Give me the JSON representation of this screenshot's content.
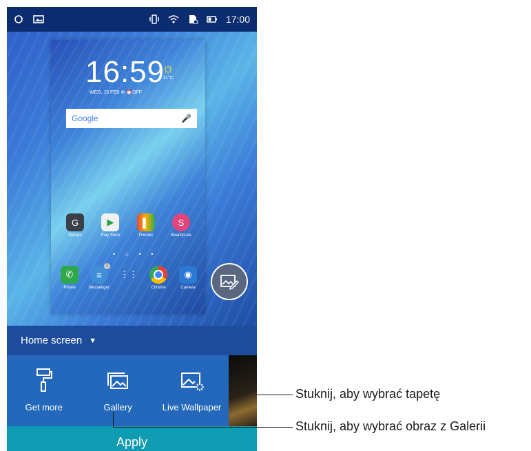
{
  "status_bar": {
    "time": "17:00"
  },
  "preview": {
    "clock": "16:59",
    "date": "WED, 15 FEB",
    "alarm": "OFF",
    "temperature": "11°C",
    "search_logo": "Google",
    "apps_row1": [
      "Google",
      "Play Store",
      "Themes",
      "BeautyLive"
    ],
    "apps_row2": [
      "Phone",
      "Messenger",
      "",
      "Chrome",
      "Camera"
    ],
    "messenger_badge": "1"
  },
  "mode_selector": {
    "label": "Home screen"
  },
  "options": {
    "get_more": "Get more",
    "gallery": "Gallery",
    "live_wallpaper": "Live Wallpaper"
  },
  "apply_label": "Apply",
  "callouts": {
    "wallpaper": "Stuknij, aby wybrać tapetę",
    "gallery": "Stuknij, aby wybrać obraz z Galerii"
  },
  "colors": {
    "status_bar": "#0b2d6f",
    "options_bg": "#2468bb",
    "apply_bg": "#0f9bb2"
  }
}
